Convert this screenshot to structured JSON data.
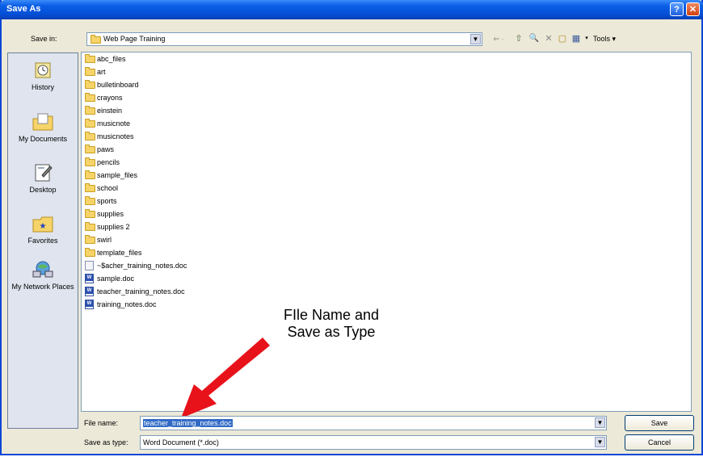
{
  "window": {
    "title": "Save As",
    "help_glyph": "?",
    "close_glyph": "✕"
  },
  "save_in": {
    "label": "Save in:",
    "value": "Web Page Training"
  },
  "toolbar": {
    "tools_label": "Tools ▾",
    "back_glyph": "⇐ ·",
    "up_glyph": "⇧",
    "search_glyph": "🔍",
    "delete_glyph": "✕",
    "newfolder_glyph": "▢",
    "views_glyph": "▦"
  },
  "places": [
    {
      "label": "History",
      "icon": "history-icon"
    },
    {
      "label": "My Documents",
      "icon": "my-documents-icon"
    },
    {
      "label": "Desktop",
      "icon": "desktop-icon"
    },
    {
      "label": "Favorites",
      "icon": "favorites-icon"
    },
    {
      "label": "My Network Places",
      "icon": "network-places-icon"
    }
  ],
  "files": [
    {
      "name": "abc_files",
      "type": "folder"
    },
    {
      "name": "art",
      "type": "folder"
    },
    {
      "name": "bulletinboard",
      "type": "folder"
    },
    {
      "name": "crayons",
      "type": "folder"
    },
    {
      "name": "einstein",
      "type": "folder"
    },
    {
      "name": "musicnote",
      "type": "folder"
    },
    {
      "name": "musicnotes",
      "type": "folder"
    },
    {
      "name": "paws",
      "type": "folder"
    },
    {
      "name": "pencils",
      "type": "folder"
    },
    {
      "name": "sample_files",
      "type": "folder"
    },
    {
      "name": "school",
      "type": "folder"
    },
    {
      "name": "sports",
      "type": "folder"
    },
    {
      "name": "supplies",
      "type": "folder"
    },
    {
      "name": "supplies 2",
      "type": "folder"
    },
    {
      "name": "swirl",
      "type": "folder"
    },
    {
      "name": "template_files",
      "type": "folder"
    },
    {
      "name": "~$acher_training_notes.doc",
      "type": "temp"
    },
    {
      "name": "sample.doc",
      "type": "doc"
    },
    {
      "name": "teacher_training_notes.doc",
      "type": "doc"
    },
    {
      "name": "training_notes.doc",
      "type": "doc"
    }
  ],
  "annotation": {
    "line1": "FIle Name and",
    "line2": "Save as Type"
  },
  "file_name": {
    "label": "File name:",
    "value": "teacher_training_notes.doc"
  },
  "save_as_type": {
    "label": "Save as type:",
    "value": "Word Document (*.doc)"
  },
  "buttons": {
    "save": "Save",
    "cancel": "Cancel"
  },
  "colors": {
    "title_bar": "#0451d8",
    "selection": "#316ac5",
    "arrow": "#e8121a",
    "dialog_bg": "#ece9d8"
  }
}
